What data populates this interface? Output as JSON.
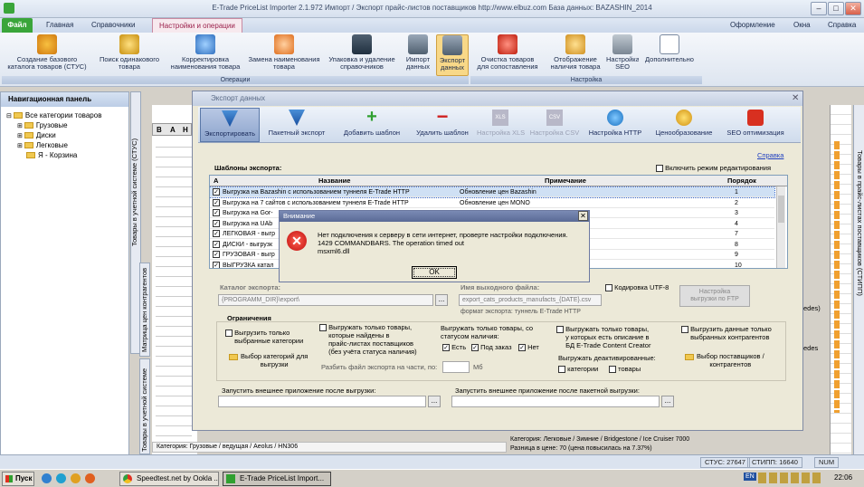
{
  "app": {
    "title": "E-Trade PriceList Importer 2.1.972    Импорт / Экспорт прайс-листов поставщиков    http://www.elbuz.com    База данных: BAZASHIN_2014",
    "minimize": "–",
    "maximize": "□",
    "close": "✕"
  },
  "menu": {
    "file": "Файл",
    "home": "Главная",
    "refs": "Справочники",
    "ops": "Настройки и операции",
    "design": "Оформление",
    "windows": "Окна",
    "help": "Справка"
  },
  "ribbon": {
    "create_catalog": "Создание базового\nкаталога товаров (СТУС)",
    "search_same": "Поиск одинакового\nтовара",
    "correct_names": "Корректировка\nнаименования товара",
    "replace_names": "Замена наименования\nтовара",
    "pack_delete": "Упаковка и удаление\nсправочников",
    "import_data": "Импорт\nданных",
    "export_data": "Экспорт\nданных",
    "clear_match": "Очистка товаров\nдля сопоставления",
    "show_availability": "Отображение\nналичия товара",
    "seo_settings": "Настройка\nSEO",
    "extra": "Дополнительно",
    "group_ops": "Операции",
    "group_settings": "Настройка"
  },
  "nav": {
    "header": "Навигационная панель",
    "root": "Все категории товаров",
    "items": [
      "Грузовые",
      "Диски",
      "Легковые",
      "Я - Корзина"
    ]
  },
  "side_tabs": {
    "left1": "Товары в учетной системе (СТУС)",
    "left2": "Матрица цен контрагентов",
    "left3": "Товары в учетной системе",
    "right": "Товары в прайс-листах поставщиков (СТИПП)"
  },
  "grid": {
    "cols": [
      "В",
      "А",
      "Н"
    ]
  },
  "dialog": {
    "title": "Экспорт данных",
    "toolbar": {
      "export": "Экспортировать",
      "batch": "Пакетный экспорт",
      "add_tpl": "Добавить шаблон",
      "del_tpl": "Удалить шаблон",
      "xls": "Настройка XLS",
      "csv": "Настройка CSV",
      "http": "Настройка HTTP",
      "pricing": "Ценообразование",
      "seo": "SEO оптимизация"
    },
    "help": "Справка",
    "templates_label": "Шаблоны экспорта:",
    "edit_mode": "Включить режим редактирования",
    "table_headers": {
      "a": "А",
      "name": "Название",
      "note": "Примечание",
      "order": "Порядок"
    },
    "rows": [
      {
        "name": "Выгрузка на Bazashin с использованием туннеля E-Trade HTTP",
        "note": "Обновление цен Bazashin",
        "order": "1"
      },
      {
        "name": "Выгрузка на 7 сайтов с использованием туннеля E-Trade HTTP",
        "note": "Обновление цен MONO",
        "order": "2"
      },
      {
        "name": "Выгрузка на Gor-",
        "note": "",
        "order": "3"
      },
      {
        "name": "Выгрузка на UAb",
        "note": "",
        "order": "4"
      },
      {
        "name": "ЛЕГКОВАЯ - выгр",
        "note": "",
        "order": "7"
      },
      {
        "name": "ДИСКИ - выгрузк",
        "note": "",
        "order": "8"
      },
      {
        "name": "ГРУЗОВАЯ - выгр",
        "note": "",
        "order": "9"
      },
      {
        "name": "ВЫГРУЗКА катал",
        "note": "",
        "order": "10"
      }
    ],
    "catalog_label": "Каталог экспорта:",
    "catalog_value": "{PROGRAMM_DIR}\\export\\",
    "file_label": "Имя выходного файла:",
    "file_value": "export_cats_products_manufacts_{DATE}.csv",
    "format_note": "формат экспорта: туннель E-Trade HTTP",
    "utf8": "Кодировка UTF-8",
    "ftp_btn": "Настройка\nвыгрузки по FTP",
    "limits_title": "Ограничения",
    "only_selected_cats": "Выгрузить только\nвыбранные категории",
    "found_in_prices": "Выгружать только товары,\nкоторые найдены в\nпрайс-листах поставщиков\n(без учёта статуса наличия)",
    "with_status": "Выгружать только товары, со\nстатусом наличия:",
    "status_yes": "Есть",
    "status_order": "Под заказ",
    "status_no": "Нет",
    "split_label": "Разбить файл экспорта на части, по:",
    "split_unit": "Mб",
    "with_desc": "Выгружать только товары,\nу которых есть описание в\nБД E-Trade Content Creator",
    "unload_deact": "Выгружать деактивированные:",
    "deact_cats": "категории",
    "deact_goods": "товары",
    "selected_contractors": "Выгрузить данные только\nвыбранных контрагентов",
    "choose_cats": "Выбор категорий для\nвыгрузки",
    "choose_suppliers": "Выбор поставщиков /\nконтрагентов",
    "run_after": "Запустить внешнее приложение после выгрузки:",
    "run_after_batch": "Запустить внешнее приложение после пакетной выгрузки:",
    "dots": "..."
  },
  "msgbox": {
    "title": "Внимание",
    "text": "Нет подключения к серверу в сети интернет, проверте настройки подключения.\n1429 COMMANDBARS. The operation timed out\nmsxml6.dll",
    "ok": "OK"
  },
  "bottom": {
    "left_cat": "Категория: Грузовые / ведущая / Aeolus / HN306",
    "right_cat": "Категория: Легковые / Зимние / Bridgestone / Ice Cruiser 7000",
    "diff": "Разница в цене: 70  (цена повысилась на 7.37%)",
    "edes1": "edes)",
    "edes2": "edes"
  },
  "status": {
    "stus": "СТУС: 27647",
    "stipp": "СТИПП: 16640",
    "num": "NUM"
  },
  "taskbar": {
    "start": "Пуск",
    "t1": "Speedtest.net by Ookla ...",
    "t2": "E-Trade PriceList Import...",
    "lang": "EN",
    "time": "22:06"
  }
}
